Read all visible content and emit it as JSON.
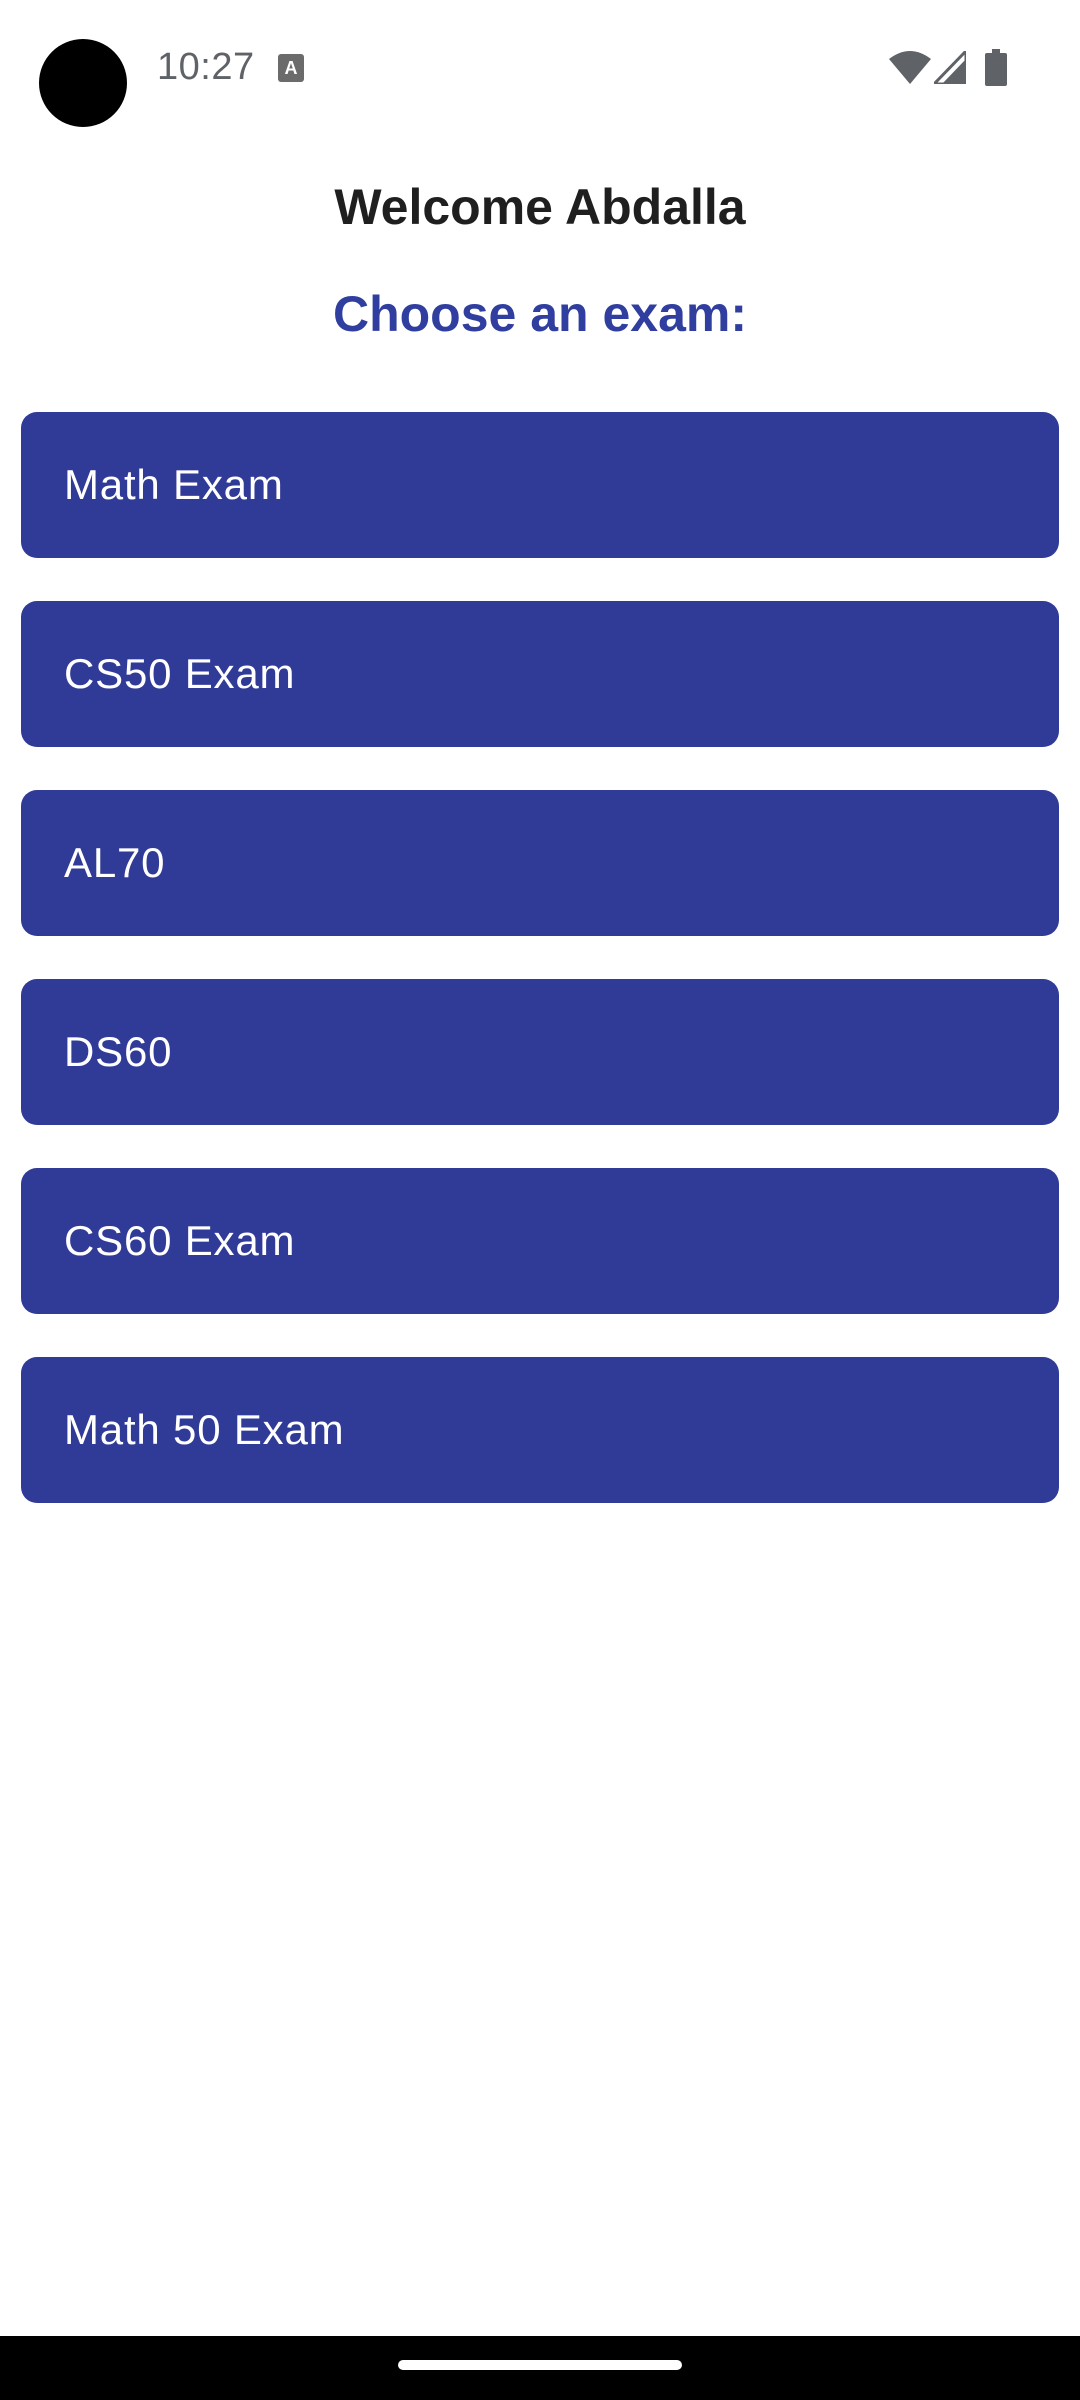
{
  "status_bar": {
    "time": "10:27",
    "notification_icon": "text-recognition-icon",
    "notification_glyph": "A",
    "wifi_icon": "wifi-icon",
    "signal_icon": "cell-signal-icon",
    "battery_icon": "battery-icon"
  },
  "header": {
    "welcome": "Welcome Abdalla",
    "prompt": "Choose an exam:"
  },
  "exams": [
    {
      "label": "Math Exam"
    },
    {
      "label": "CS50 Exam"
    },
    {
      "label": "AL70"
    },
    {
      "label": "DS60"
    },
    {
      "label": "CS60 Exam"
    },
    {
      "label": "Math 50 Exam"
    }
  ],
  "colors": {
    "accent": "#303f9f",
    "button_background": "#303a97",
    "button_text": "#ffffff",
    "title_text": "#1f1f1f"
  }
}
